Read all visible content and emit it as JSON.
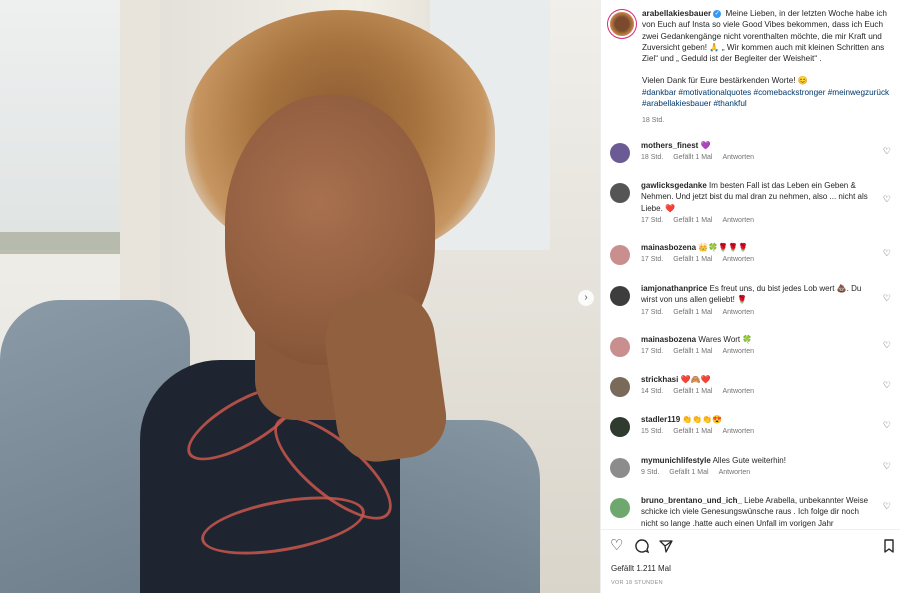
{
  "post": {
    "username": "arabellakiesbauer",
    "caption": "Meine Lieben, in der letzten Woche habe ich von Euch auf Insta so viele Good Vibes bekommen, dass ich Euch zwei Gedankengänge nicht vorenthalten möchte, die mir Kraft und Zuversicht geben! 🙏 „ Wir kommen auch mit kleinen Schritten ans Ziel“ und „ Geduld ist der Begleiter der Weisheit“ .",
    "thanks": "Vielen Dank für Eure bestärkenden Worte! 😊",
    "hashtags": "#dankbar #motivationalquotes #comebackstronger #meinwegzurück #arabellakiesbauer #thankful",
    "age": "18 Std."
  },
  "comments": [
    {
      "user": "mothers_finest",
      "text": "💜",
      "age": "18 Std.",
      "likes": "Gefällt 1 Mal",
      "reply": "Antworten",
      "avatar_color": "#6b5b95"
    },
    {
      "user": "gawlicksgedanke",
      "text": "Im besten Fall ist das Leben ein Geben & Nehmen. Und jetzt bist du mal dran zu nehmen, also ... nicht als Liebe. ❤️",
      "age": "17 Std.",
      "likes": "Gefällt 1 Mal",
      "reply": "Antworten",
      "avatar_color": "#555555"
    },
    {
      "user": "mainasbozena",
      "text": "👑🍀🌹🌹🌹",
      "age": "17 Std.",
      "likes": "Gefällt 1 Mal",
      "reply": "Antworten",
      "avatar_color": "#c98f8f"
    },
    {
      "user": "iamjonathanprice",
      "text": "Es freut uns, du bist jedes Lob wert 💩. Du wirst von uns allen geliebt! 🌹",
      "age": "17 Std.",
      "likes": "Gefällt 1 Mal",
      "reply": "Antworten",
      "avatar_color": "#3d3d3d"
    },
    {
      "user": "mainasbozena",
      "text": "Wares Wort 🍀",
      "age": "17 Std.",
      "likes": "Gefällt 1 Mal",
      "reply": "Antworten",
      "avatar_color": "#c98f8f"
    },
    {
      "user": "strickhasi",
      "text": "❤️🙈❤️",
      "age": "14 Std.",
      "likes": "Gefällt 1 Mal",
      "reply": "Antworten",
      "avatar_color": "#7a6a5a"
    },
    {
      "user": "stadler119",
      "text": "👏👏👏😍",
      "age": "15 Std.",
      "likes": "Gefällt 1 Mal",
      "reply": "Antworten",
      "avatar_color": "#2f3b2f"
    },
    {
      "user": "mymunichlifestyle",
      "text": "Alles Gute weiterhin!",
      "age": "9 Std.",
      "likes": "Gefällt 1 Mal",
      "reply": "Antworten",
      "avatar_color": "#8c8c8c"
    },
    {
      "user": "bruno_brentano_und_ich_",
      "text": "Liebe Arabella, unbekannter Weise schicke ich viele Genesungswünsche raus . Ich folge dir noch nicht so lange .hatte auch einen Unfall im vorigen Jahr",
      "age": "",
      "likes": "",
      "reply": "",
      "avatar_color": "#6fa86f"
    }
  ],
  "footer": {
    "likes": "Gefällt 1.211 Mal",
    "time": "VOR 18 STUNDEN"
  },
  "icons": {
    "like": "heart-icon",
    "comment": "comment-icon",
    "share": "share-icon",
    "save": "bookmark-icon",
    "next": "chevron-right-icon"
  }
}
